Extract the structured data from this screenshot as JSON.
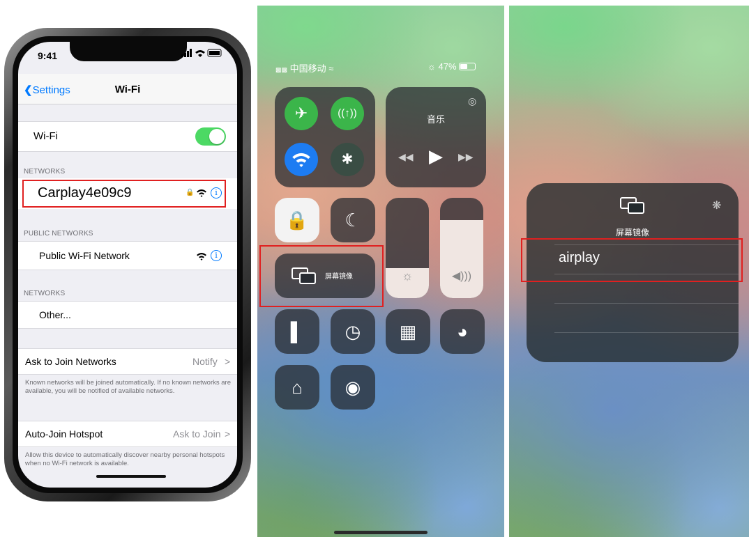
{
  "settings": {
    "status_time": "9:41",
    "back_label": "Settings",
    "title": "Wi-Fi",
    "wifi_label": "Wi-Fi",
    "networks_header": "NETWORKS",
    "highlighted_network": "Carplay4e09c9",
    "public_header": "PUBLIC NETWORKS",
    "public_network": "Public Wi-Fi Network",
    "networks_header_2": "NETWORKS",
    "other_label": "Other...",
    "ask_to_join_label": "Ask to Join Networks",
    "ask_to_join_value": "Notify",
    "ask_to_join_note": "Known networks will be joined automatically. If no known networks are available, you will be notified of available networks.",
    "auto_join_label": "Auto-Join Hotspot",
    "auto_join_value": "Ask to Join",
    "auto_join_note": "Allow this device to automatically discover nearby personal hotspots when no Wi-Fi network is available.",
    "info_glyph": "i",
    "chevron": ">"
  },
  "control_center": {
    "carrier": "中国移动",
    "battery": "47%",
    "music_label": "音乐",
    "mirror_label": "屏幕镜像",
    "brightness_level": 0.3,
    "volume_level": 0.78
  },
  "airplay": {
    "title": "屏幕镜像",
    "device": "airplay"
  },
  "colors": {
    "accent": "#007aff",
    "toggle_on": "#4cd964",
    "highlight": "#e02020",
    "wifi_blue": "#1d7cf2",
    "cell_green": "#34c759"
  }
}
